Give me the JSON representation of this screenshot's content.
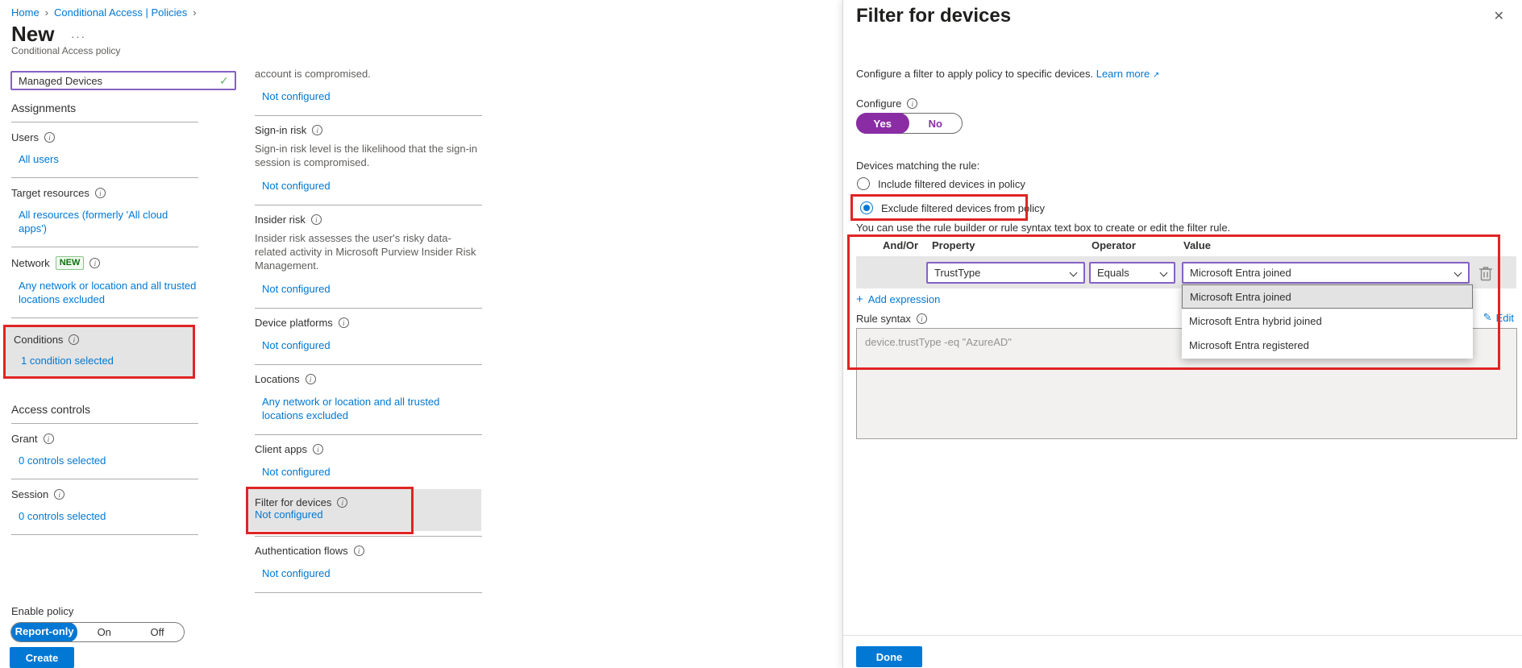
{
  "colors": {
    "accent": "#0078d4",
    "highlight_red": "#e02424",
    "toggle_purple": "#8a2da5",
    "select_border": "#8661c5",
    "badge_green": "#0e700e",
    "highlight_gray": "#e4e4e4"
  },
  "icons": {
    "info": "i",
    "breadcrumb_chevron": "›",
    "ellipsis": "···",
    "check": "✓",
    "close": "✕",
    "add": "+",
    "edit_pencil": "✎",
    "external_link": "↗"
  },
  "breadcrumb": {
    "items": [
      "Home",
      "Conditional Access | Policies"
    ]
  },
  "header": {
    "title": "New",
    "subtitle": "Conditional Access policy",
    "name_value": "Managed Devices"
  },
  "left": {
    "assignments_header": "Assignments",
    "users_label": "Users",
    "users_link": "All users",
    "target_label": "Target resources",
    "target_link": "All resources (formerly 'All cloud apps')",
    "network_label": "Network",
    "network_badge": "NEW",
    "network_link": "Any network or location and all trusted locations excluded",
    "conditions_label": "Conditions",
    "conditions_link": "1 condition selected",
    "access_header": "Access controls",
    "grant_label": "Grant",
    "grant_link": "0 controls selected",
    "session_label": "Session",
    "session_link": "0 controls selected",
    "enable_policy_label": "Enable policy",
    "enable_options": [
      "Report-only",
      "On",
      "Off"
    ],
    "enable_selected": "Report-only",
    "create_button": "Create"
  },
  "middle": {
    "truncated_text": "account is compromised.",
    "not_configured": "Not configured",
    "signin_label": "Sign-in risk",
    "signin_desc": "Sign-in risk level is the likelihood that the sign-in session is compromised.",
    "insider_label": "Insider risk",
    "insider_desc": "Insider risk assesses the user's risky data-related activity in Microsoft Purview Insider Risk Management.",
    "device_platforms_label": "Device platforms",
    "locations_label": "Locations",
    "locations_link": "Any network or location and all trusted locations excluded",
    "client_apps_label": "Client apps",
    "filter_devices_label": "Filter for devices",
    "auth_flows_label": "Authentication flows"
  },
  "panel": {
    "title": "Filter for devices",
    "intro": "Configure a filter to apply policy to specific devices.",
    "learn_more": "Learn more",
    "configure_label": "Configure",
    "toggle_yes": "Yes",
    "toggle_no": "No",
    "matching_label": "Devices matching the rule:",
    "radio_include": "Include filtered devices in policy",
    "radio_exclude": "Exclude filtered devices from policy",
    "helper": "You can use the rule builder or rule syntax text box to create or edit the filter rule.",
    "table_headers": [
      "And/Or",
      "Property",
      "Operator",
      "Value"
    ],
    "row": {
      "property": "TrustType",
      "operator": "Equals",
      "value": "Microsoft Entra joined"
    },
    "add_expression": "Add expression",
    "rule_syntax_label": "Rule syntax",
    "edit_link": "Edit",
    "rule_syntax_value": "device.trustType -eq \"AzureAD\"",
    "dropdown_options": [
      "Microsoft Entra joined",
      "Microsoft Entra hybrid joined",
      "Microsoft Entra registered"
    ],
    "done_button": "Done"
  }
}
